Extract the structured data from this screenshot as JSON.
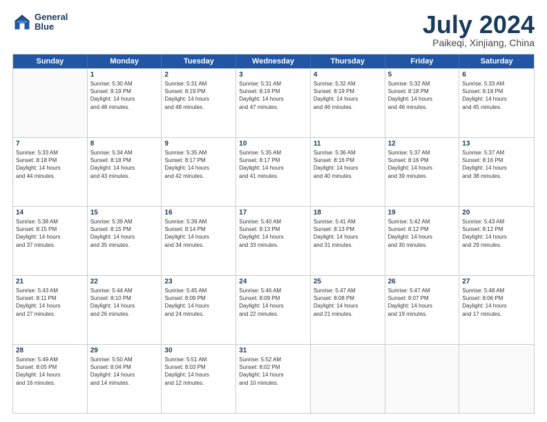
{
  "header": {
    "logo_line1": "General",
    "logo_line2": "Blue",
    "title": "July 2024",
    "location": "Paikeqi, Xinjiang, China"
  },
  "days_of_week": [
    "Sunday",
    "Monday",
    "Tuesday",
    "Wednesday",
    "Thursday",
    "Friday",
    "Saturday"
  ],
  "weeks": [
    [
      {
        "day": "",
        "info": ""
      },
      {
        "day": "1",
        "info": "Sunrise: 5:30 AM\nSunset: 8:19 PM\nDaylight: 14 hours\nand 48 minutes."
      },
      {
        "day": "2",
        "info": "Sunrise: 5:31 AM\nSunset: 8:19 PM\nDaylight: 14 hours\nand 48 minutes."
      },
      {
        "day": "3",
        "info": "Sunrise: 5:31 AM\nSunset: 8:19 PM\nDaylight: 14 hours\nand 47 minutes."
      },
      {
        "day": "4",
        "info": "Sunrise: 5:32 AM\nSunset: 8:19 PM\nDaylight: 14 hours\nand 46 minutes."
      },
      {
        "day": "5",
        "info": "Sunrise: 5:32 AM\nSunset: 8:18 PM\nDaylight: 14 hours\nand 46 minutes."
      },
      {
        "day": "6",
        "info": "Sunrise: 5:33 AM\nSunset: 8:18 PM\nDaylight: 14 hours\nand 45 minutes."
      }
    ],
    [
      {
        "day": "7",
        "info": "Sunrise: 5:33 AM\nSunset: 8:18 PM\nDaylight: 14 hours\nand 44 minutes."
      },
      {
        "day": "8",
        "info": "Sunrise: 5:34 AM\nSunset: 8:18 PM\nDaylight: 14 hours\nand 43 minutes."
      },
      {
        "day": "9",
        "info": "Sunrise: 5:35 AM\nSunset: 8:17 PM\nDaylight: 14 hours\nand 42 minutes."
      },
      {
        "day": "10",
        "info": "Sunrise: 5:35 AM\nSunset: 8:17 PM\nDaylight: 14 hours\nand 41 minutes."
      },
      {
        "day": "11",
        "info": "Sunrise: 5:36 AM\nSunset: 8:16 PM\nDaylight: 14 hours\nand 40 minutes."
      },
      {
        "day": "12",
        "info": "Sunrise: 5:37 AM\nSunset: 8:16 PM\nDaylight: 14 hours\nand 39 minutes."
      },
      {
        "day": "13",
        "info": "Sunrise: 5:37 AM\nSunset: 8:16 PM\nDaylight: 14 hours\nand 38 minutes."
      }
    ],
    [
      {
        "day": "14",
        "info": "Sunrise: 5:38 AM\nSunset: 8:15 PM\nDaylight: 14 hours\nand 37 minutes."
      },
      {
        "day": "15",
        "info": "Sunrise: 5:39 AM\nSunset: 8:15 PM\nDaylight: 14 hours\nand 35 minutes."
      },
      {
        "day": "16",
        "info": "Sunrise: 5:39 AM\nSunset: 8:14 PM\nDaylight: 14 hours\nand 34 minutes."
      },
      {
        "day": "17",
        "info": "Sunrise: 5:40 AM\nSunset: 8:13 PM\nDaylight: 14 hours\nand 33 minutes."
      },
      {
        "day": "18",
        "info": "Sunrise: 5:41 AM\nSunset: 8:13 PM\nDaylight: 14 hours\nand 31 minutes."
      },
      {
        "day": "19",
        "info": "Sunrise: 5:42 AM\nSunset: 8:12 PM\nDaylight: 14 hours\nand 30 minutes."
      },
      {
        "day": "20",
        "info": "Sunrise: 5:43 AM\nSunset: 8:12 PM\nDaylight: 14 hours\nand 29 minutes."
      }
    ],
    [
      {
        "day": "21",
        "info": "Sunrise: 5:43 AM\nSunset: 8:11 PM\nDaylight: 14 hours\nand 27 minutes."
      },
      {
        "day": "22",
        "info": "Sunrise: 5:44 AM\nSunset: 8:10 PM\nDaylight: 14 hours\nand 26 minutes."
      },
      {
        "day": "23",
        "info": "Sunrise: 5:45 AM\nSunset: 8:09 PM\nDaylight: 14 hours\nand 24 minutes."
      },
      {
        "day": "24",
        "info": "Sunrise: 5:46 AM\nSunset: 8:09 PM\nDaylight: 14 hours\nand 22 minutes."
      },
      {
        "day": "25",
        "info": "Sunrise: 5:47 AM\nSunset: 8:08 PM\nDaylight: 14 hours\nand 21 minutes."
      },
      {
        "day": "26",
        "info": "Sunrise: 5:47 AM\nSunset: 8:07 PM\nDaylight: 14 hours\nand 19 minutes."
      },
      {
        "day": "27",
        "info": "Sunrise: 5:48 AM\nSunset: 8:06 PM\nDaylight: 14 hours\nand 17 minutes."
      }
    ],
    [
      {
        "day": "28",
        "info": "Sunrise: 5:49 AM\nSunset: 8:05 PM\nDaylight: 14 hours\nand 16 minutes."
      },
      {
        "day": "29",
        "info": "Sunrise: 5:50 AM\nSunset: 8:04 PM\nDaylight: 14 hours\nand 14 minutes."
      },
      {
        "day": "30",
        "info": "Sunrise: 5:51 AM\nSunset: 8:03 PM\nDaylight: 14 hours\nand 12 minutes."
      },
      {
        "day": "31",
        "info": "Sunrise: 5:52 AM\nSunset: 8:02 PM\nDaylight: 14 hours\nand 10 minutes."
      },
      {
        "day": "",
        "info": ""
      },
      {
        "day": "",
        "info": ""
      },
      {
        "day": "",
        "info": ""
      }
    ]
  ]
}
